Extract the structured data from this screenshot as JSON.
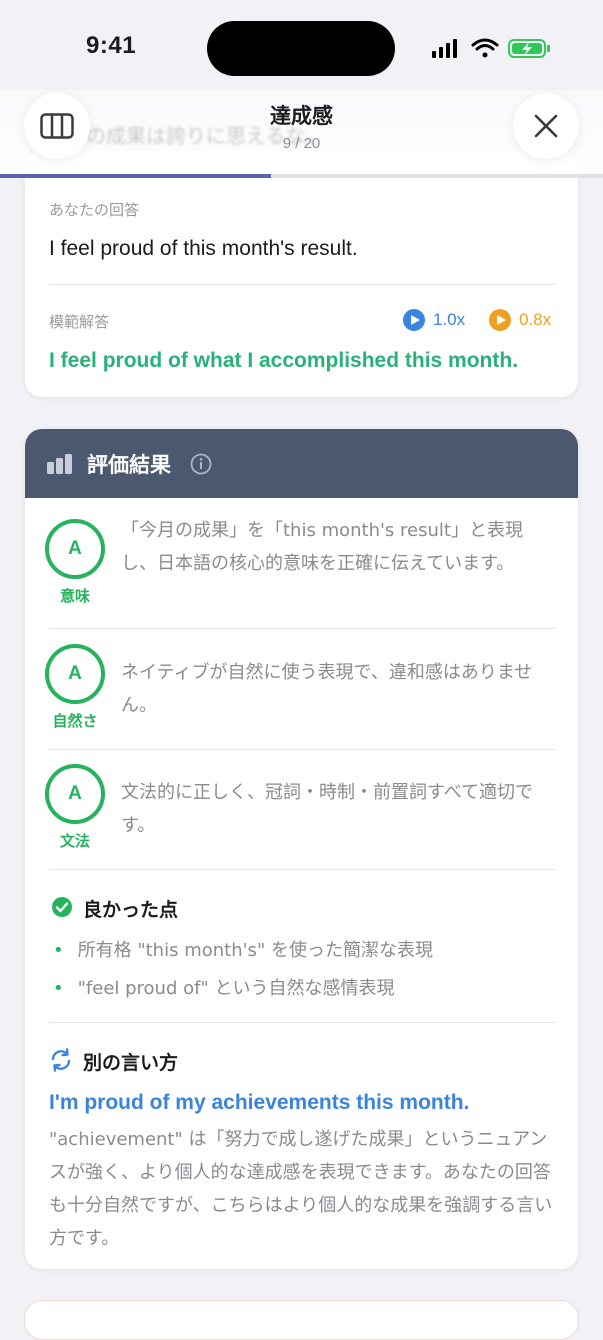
{
  "status_bar": {
    "time": "9:41"
  },
  "header": {
    "title": "達成感",
    "progress_text": "9 / 20",
    "progress_fraction": 0.45,
    "ghost_prompt": "今月の成果は誇りに思えるな。"
  },
  "answer": {
    "your_label": "あなたの回答",
    "your_text": "I feel proud of this month's result.",
    "model_label": "模範解答",
    "speed_normal": "1.0x",
    "speed_slow": "0.8x",
    "model_text": "I feel proud of what I accomplished this month."
  },
  "evaluation": {
    "title": "評価結果",
    "grades": [
      {
        "grade": "A",
        "label": "意味",
        "comment": "「今月の成果」を「this month's result」と表現し、日本語の核心的意味を正確に伝えています。"
      },
      {
        "grade": "A",
        "label": "自然さ",
        "comment": "ネイティブが自然に使う表現で、違和感はありません。"
      },
      {
        "grade": "A",
        "label": "文法",
        "comment": "文法的に正しく、冠詞・時制・前置詞すべて適切です。"
      }
    ],
    "good_points_title": "良かった点",
    "good_points": [
      "所有格 \"this month's\" を使った簡潔な表現",
      "\"feel proud of\" という自然な感情表現"
    ],
    "alternative_title": "別の言い方",
    "alternative_phrase": "I'm proud of my achievements this month.",
    "alternative_explanation": "\"achievement\" は「努力で成し遂げた成果」というニュアンスが強く、より個人的な達成感を表現できます。あなたの回答も十分自然ですが、こちらはより個人的な成果を強調する言い方です。"
  },
  "colors": {
    "accent_green": "#27b35e",
    "model_green": "#27b27a",
    "alt_blue": "#3a84e0",
    "header_slate": "#4b5870",
    "progress": "#5d63a8",
    "speed_blue": "#3a84e0",
    "speed_orange": "#f0a020"
  },
  "icons": [
    "columns-icon",
    "close-icon",
    "play-icon",
    "bar-chart-icon",
    "info-icon",
    "check-circle-icon",
    "refresh-icon"
  ]
}
